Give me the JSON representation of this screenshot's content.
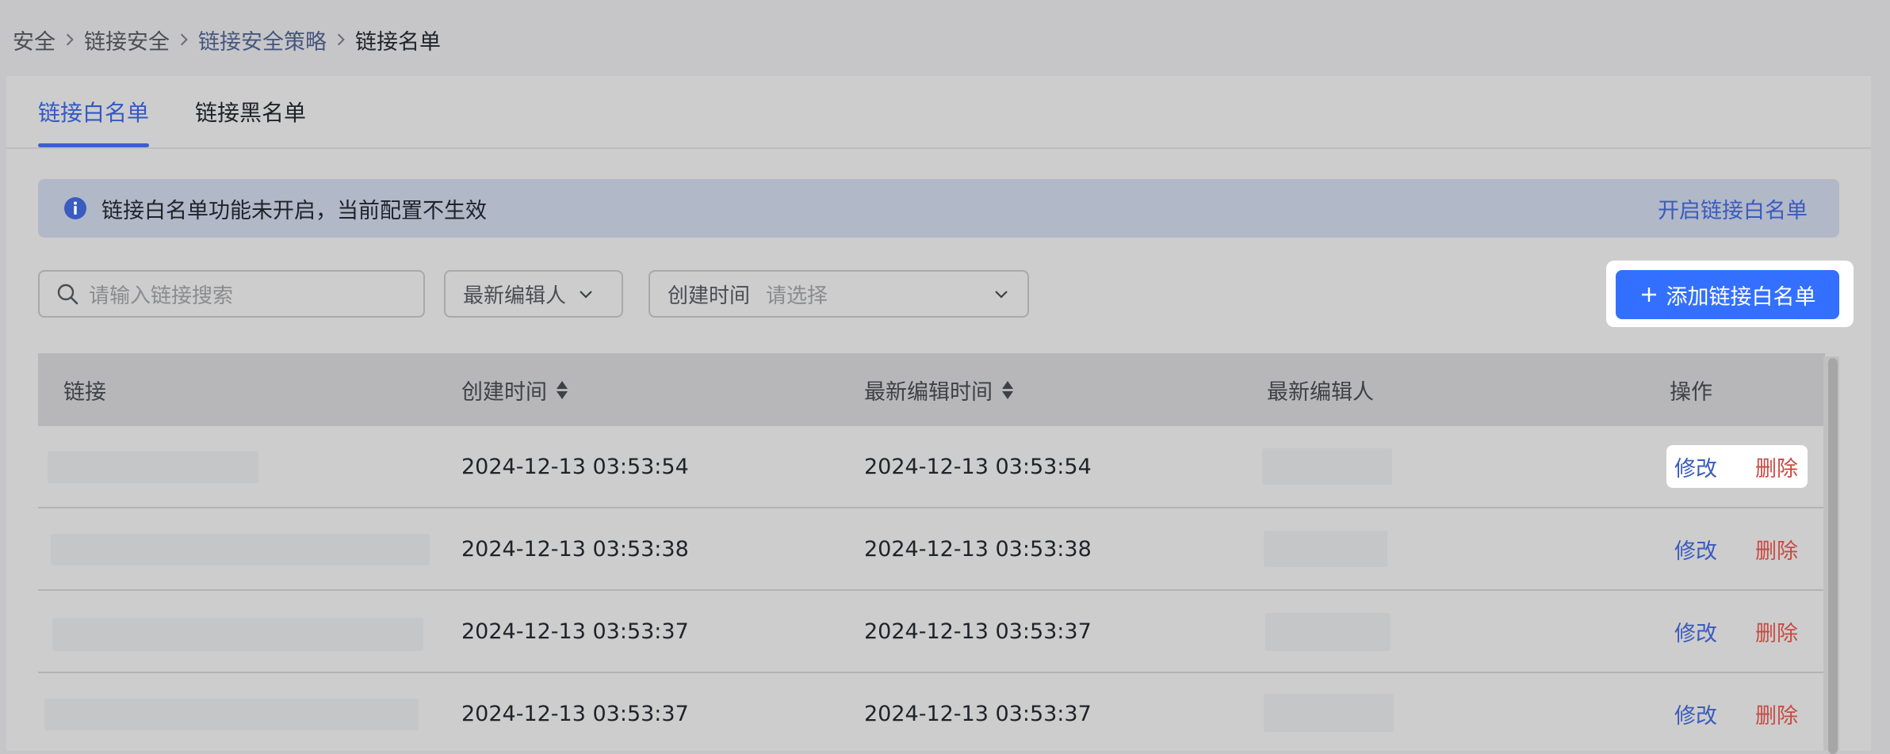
{
  "breadcrumb": [
    {
      "label": "安全"
    },
    {
      "label": "链接安全"
    },
    {
      "label": "链接安全策略"
    },
    {
      "label": "链接名单"
    }
  ],
  "tabs": [
    {
      "label": "链接白名单",
      "active": true
    },
    {
      "label": "链接黑名单",
      "active": false
    }
  ],
  "banner": {
    "message": "链接白名单功能未开启，当前配置不生效",
    "action": "开启链接白名单"
  },
  "filters": {
    "search_placeholder": "请输入链接搜索",
    "editor_label": "最新编辑人",
    "created_label": "创建时间",
    "created_placeholder": "请选择"
  },
  "add_button": {
    "label": "添加链接白名单"
  },
  "table": {
    "columns": [
      "链接",
      "创建时间",
      "最新编辑时间",
      "最新编辑人",
      "操作"
    ],
    "rows": [
      {
        "created": "2024-12-13 03:53:54",
        "edited": "2024-12-13 03:53:54",
        "edit": "修改",
        "delete": "删除"
      },
      {
        "created": "2024-12-13 03:53:38",
        "edited": "2024-12-13 03:53:38",
        "edit": "修改",
        "delete": "删除"
      },
      {
        "created": "2024-12-13 03:53:37",
        "edited": "2024-12-13 03:53:37",
        "edit": "修改",
        "delete": "删除"
      },
      {
        "created": "2024-12-13 03:53:37",
        "edited": "2024-12-13 03:53:37",
        "edit": "修改",
        "delete": "删除"
      }
    ]
  },
  "colors": {
    "accent": "#3370ff",
    "link": "#3a5bbf",
    "danger": "#c94a43",
    "tab_active": "#3358c7"
  }
}
